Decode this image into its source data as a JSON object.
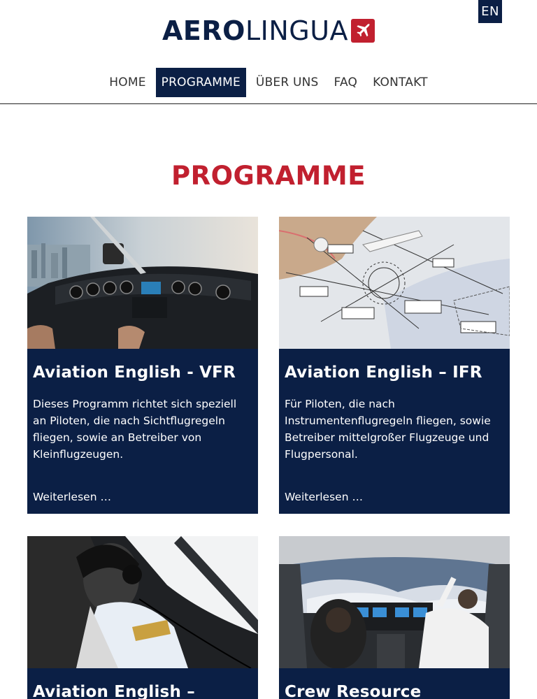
{
  "header": {
    "lang_button": "EN",
    "logo": {
      "part1": "AERO",
      "part2": "LINGUA",
      "icon": "airplane-icon"
    },
    "nav": [
      {
        "label": "HOME",
        "active": false
      },
      {
        "label": "PROGRAMME",
        "active": true
      },
      {
        "label": "ÜBER UNS",
        "active": false
      },
      {
        "label": "FAQ",
        "active": false
      },
      {
        "label": "KONTAKT",
        "active": false
      }
    ]
  },
  "main": {
    "title": "PROGRAMME",
    "cards": [
      {
        "title": "Aviation English - VFR",
        "description": "Dieses Programm richtet sich speziell an Piloten, die nach Sichtflugregeln fliegen, sowie an Betreiber von Kleinflugzeugen.",
        "link": "Weiterlesen …"
      },
      {
        "title": "Aviation English – IFR",
        "description": "Für Piloten, die nach Instrumentenflugregeln fliegen, sowie Betreiber mittelgroßer Flugzeuge und Flugpersonal.",
        "link": "Weiterlesen …"
      },
      {
        "title": "Aviation English –",
        "description": "",
        "link": ""
      },
      {
        "title": "Crew Resource",
        "description": "",
        "link": ""
      }
    ]
  },
  "colors": {
    "navy": "#0b1f45",
    "accent_red": "#c1202f"
  }
}
